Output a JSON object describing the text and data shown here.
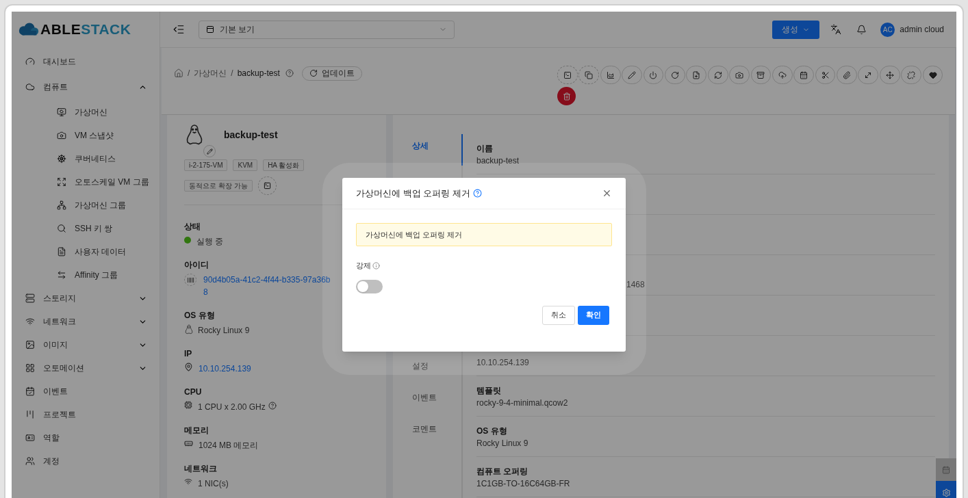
{
  "header": {
    "logo_parts": [
      "ABLE",
      "STACK"
    ],
    "view_select": "기본 보기",
    "create_button": "생성",
    "avatar": "AC",
    "user": "admin cloud"
  },
  "sidebar": [
    {
      "label": "대시보드"
    },
    {
      "label": "컴퓨트",
      "expanded": true,
      "children": [
        {
          "label": "가상머신"
        },
        {
          "label": "VM 스냅샷"
        },
        {
          "label": "쿠버네티스"
        },
        {
          "label": "오토스케일 VM 그룹"
        },
        {
          "label": "가상머신 그룹"
        },
        {
          "label": "SSH 키 쌍"
        },
        {
          "label": "사용자 데이터"
        },
        {
          "label": "Affinity 그룹"
        }
      ]
    },
    {
      "label": "스토리지",
      "expanded": false
    },
    {
      "label": "네트워크",
      "expanded": false
    },
    {
      "label": "이미지",
      "expanded": false
    },
    {
      "label": "오토메이션",
      "expanded": false
    },
    {
      "label": "이벤트"
    },
    {
      "label": "프로젝트"
    },
    {
      "label": "역할"
    },
    {
      "label": "계정"
    }
  ],
  "breadcrumb": {
    "separator": "/",
    "items": [
      "가상머신",
      "backup-test"
    ]
  },
  "update_button": "업데이트",
  "vm": {
    "name": "backup-test",
    "tags": [
      "i-2-175-VM",
      "KVM",
      "HA 활성화",
      "동적으로 확장 가능"
    ],
    "fields": [
      {
        "kind": "status",
        "label": "상태",
        "value": "실행 중",
        "color": "#31760f"
      },
      {
        "kind": "id",
        "label": "아이디",
        "lines": [
          "90d4b05a-41c2-4f44-b335-97a36b",
          "8"
        ]
      },
      {
        "kind": "os",
        "label": "OS 유형",
        "value": "Rocky Linux 9"
      },
      {
        "kind": "ip",
        "label": "IP",
        "value": "10.10.254.139"
      },
      {
        "kind": "cpu",
        "label": "CPU",
        "value": "1 CPU x 2.00 GHz"
      },
      {
        "kind": "memory",
        "label": "메모리",
        "value": "1024 MB 메모리"
      },
      {
        "kind": "network",
        "label": "네트워크",
        "value": "1 NIC(s)"
      }
    ]
  },
  "detail_tabs": [
    {
      "kind": "tab",
      "label": "상세",
      "selected": true
    },
    {
      "kind": "covered"
    },
    {
      "kind": "covered"
    },
    {
      "kind": "covered"
    },
    {
      "kind": "covered"
    },
    {
      "kind": "covered"
    },
    {
      "kind": "covered"
    },
    {
      "kind": "tab",
      "label": "설정",
      "selected": false
    },
    {
      "kind": "tab",
      "label": "이벤트",
      "selected": false
    },
    {
      "kind": "tab",
      "label": "코멘트",
      "selected": false
    }
  ],
  "details": [
    {
      "kind": "row",
      "label": "이름",
      "value": "backup-test"
    },
    {
      "kind": "covered"
    },
    {
      "kind": "covered"
    },
    {
      "kind": "tail",
      "value": "1468"
    },
    {
      "kind": "covered"
    },
    {
      "kind": "row",
      "value": "10.10.254.139"
    },
    {
      "kind": "row",
      "label": "템플릿",
      "value": "rocky-9-4-minimal.qcow2"
    },
    {
      "kind": "row",
      "label": "OS 유형",
      "value": "Rocky Linux 9"
    },
    {
      "kind": "row",
      "label": "컴퓨트 오퍼링",
      "value": "1C1GB-TO-16C64GB-FR"
    }
  ],
  "modal": {
    "title": "가상머신에 백업 오퍼링 제거",
    "alert": "가상머신에 백업 오퍼링 제거",
    "force_label": "강제",
    "force_on": false,
    "buttons": [
      "취소",
      "확인"
    ]
  }
}
